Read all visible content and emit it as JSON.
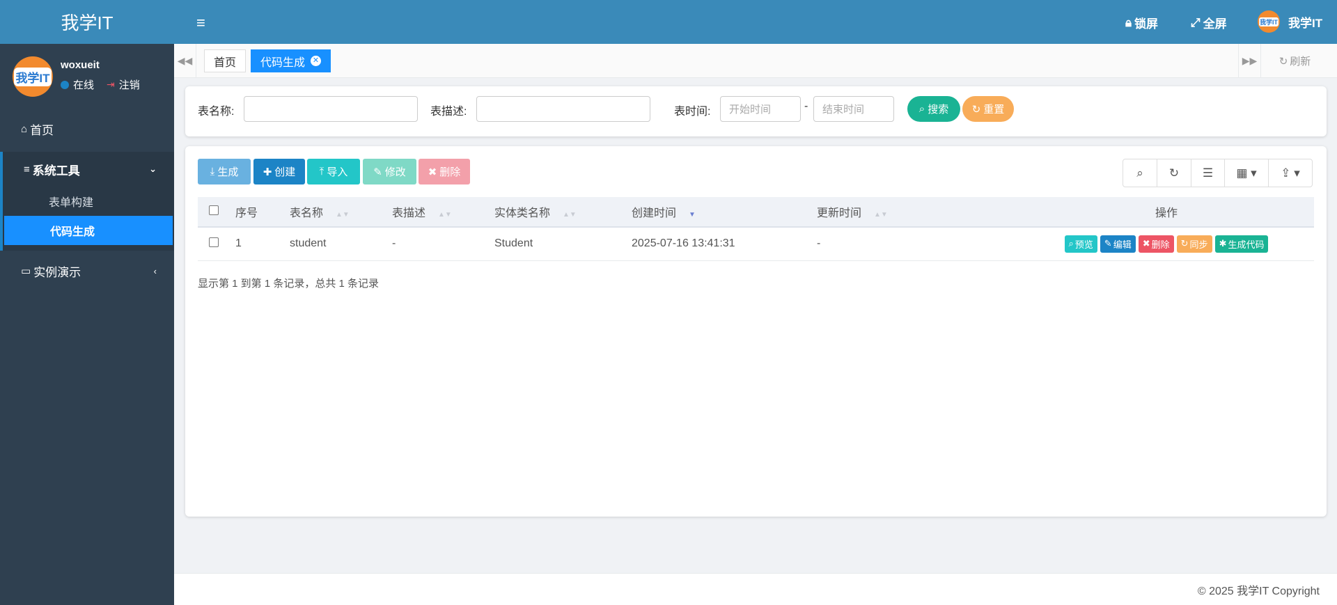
{
  "brand": "我学IT",
  "user": {
    "name": "woxueit",
    "status": "在线",
    "logout": "注销",
    "avatar_text": "我学IT"
  },
  "sidebar": {
    "home": "首页",
    "group": "系统工具",
    "sub_items": [
      {
        "label": "表单构建"
      },
      {
        "label": "代码生成"
      }
    ],
    "demo": "实例演示"
  },
  "topbar": {
    "lock": "锁屏",
    "fullscreen": "全屏",
    "brand_right": "我学IT",
    "avatar_text": "我学IT"
  },
  "tabs": [
    {
      "label": "首页"
    },
    {
      "label": "代码生成"
    }
  ],
  "tabs_refresh": "刷新",
  "search": {
    "table_name_label": "表名称:",
    "table_desc_label": "表描述:",
    "table_time_label": "表时间:",
    "start_placeholder": "开始时间",
    "end_placeholder": "结束时间",
    "range_sep": "-",
    "search_btn": "搜索",
    "reset_btn": "重置"
  },
  "toolbar": {
    "generate": "生成",
    "create": "创建",
    "import": "导入",
    "edit": "修改",
    "delete": "删除"
  },
  "table": {
    "headers": [
      "序号",
      "表名称",
      "表描述",
      "实体类名称",
      "创建时间",
      "更新时间",
      "操作"
    ],
    "rows": [
      {
        "index": "1",
        "name": "student",
        "desc": "-",
        "entity": "Student",
        "created": "2025-07-16 13:41:31",
        "updated": "-"
      }
    ],
    "ops": [
      "预览",
      "编辑",
      "删除",
      "同步",
      "生成代码"
    ]
  },
  "summary": "显示第 1 到第 1 条记录，总共 1 条记录",
  "footer": "© 2025 我学IT Copyright",
  "colors": {
    "brand_blue": "#3a8ab9",
    "sidebar_bg": "#2f4050",
    "active_blue": "#1890ff",
    "primary": "#1c84c6",
    "success": "#1ab394",
    "warning": "#f8ac59",
    "danger": "#ed5565",
    "info": "#23c6c8"
  }
}
